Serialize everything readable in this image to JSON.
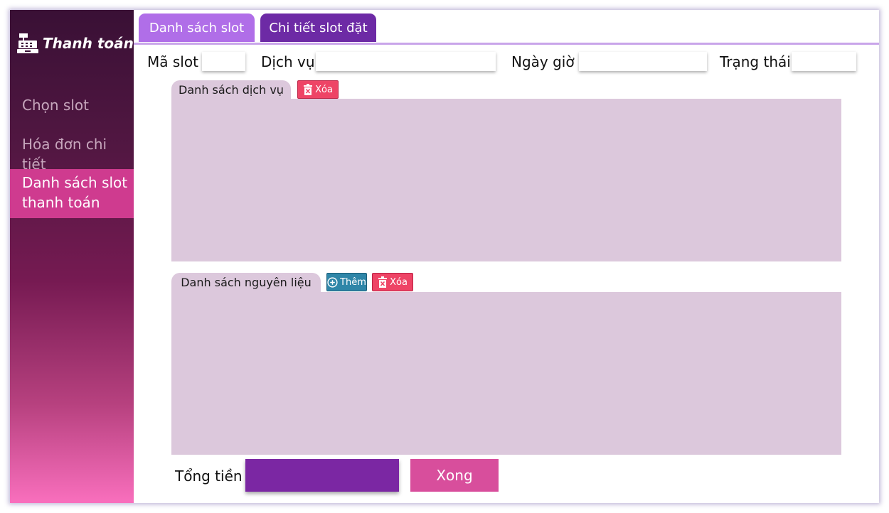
{
  "app": {
    "title": "Thanh toán",
    "logo_icon": "cash-register-icon"
  },
  "colors": {
    "accent": "#cf3b8f",
    "tab_light": "#b06ee8",
    "tab_dark": "#6d2aa5",
    "panel": "#dcc8dc",
    "delete": "#ee4466",
    "add": "#2f86a8",
    "total": "#7b27a3",
    "done": "#d84e9c"
  },
  "sidebar": {
    "items": [
      {
        "label": "Chọn slot",
        "active": false
      },
      {
        "label": "Hóa đơn chi tiết",
        "active": false
      },
      {
        "label": "Danh sách slot thanh toán",
        "active": true
      }
    ]
  },
  "tabs": [
    {
      "label": "Danh sách slot",
      "active": false
    },
    {
      "label": "Chi tiết slot đặt",
      "active": true
    }
  ],
  "fields": {
    "ma_slot": {
      "label": "Mã slot",
      "value": ""
    },
    "dich_vu": {
      "label": "Dịch vụ",
      "value": ""
    },
    "ngay_gio": {
      "label": "Ngày giờ",
      "value": ""
    },
    "trang_thai": {
      "label": "Trạng thái",
      "value": ""
    }
  },
  "services_section": {
    "title": "Danh sách dịch vụ",
    "delete_label": "Xóa",
    "delete_icon": "trash-x-icon",
    "rows": []
  },
  "ingredients_section": {
    "title": "Danh sách nguyên liệu",
    "add_label": "Thêm",
    "add_icon": "plus-circle-icon",
    "delete_label": "Xóa",
    "delete_icon": "trash-x-icon",
    "rows": []
  },
  "footer": {
    "total_label": "Tổng tiền",
    "total_value": "",
    "done_label": "Xong"
  }
}
